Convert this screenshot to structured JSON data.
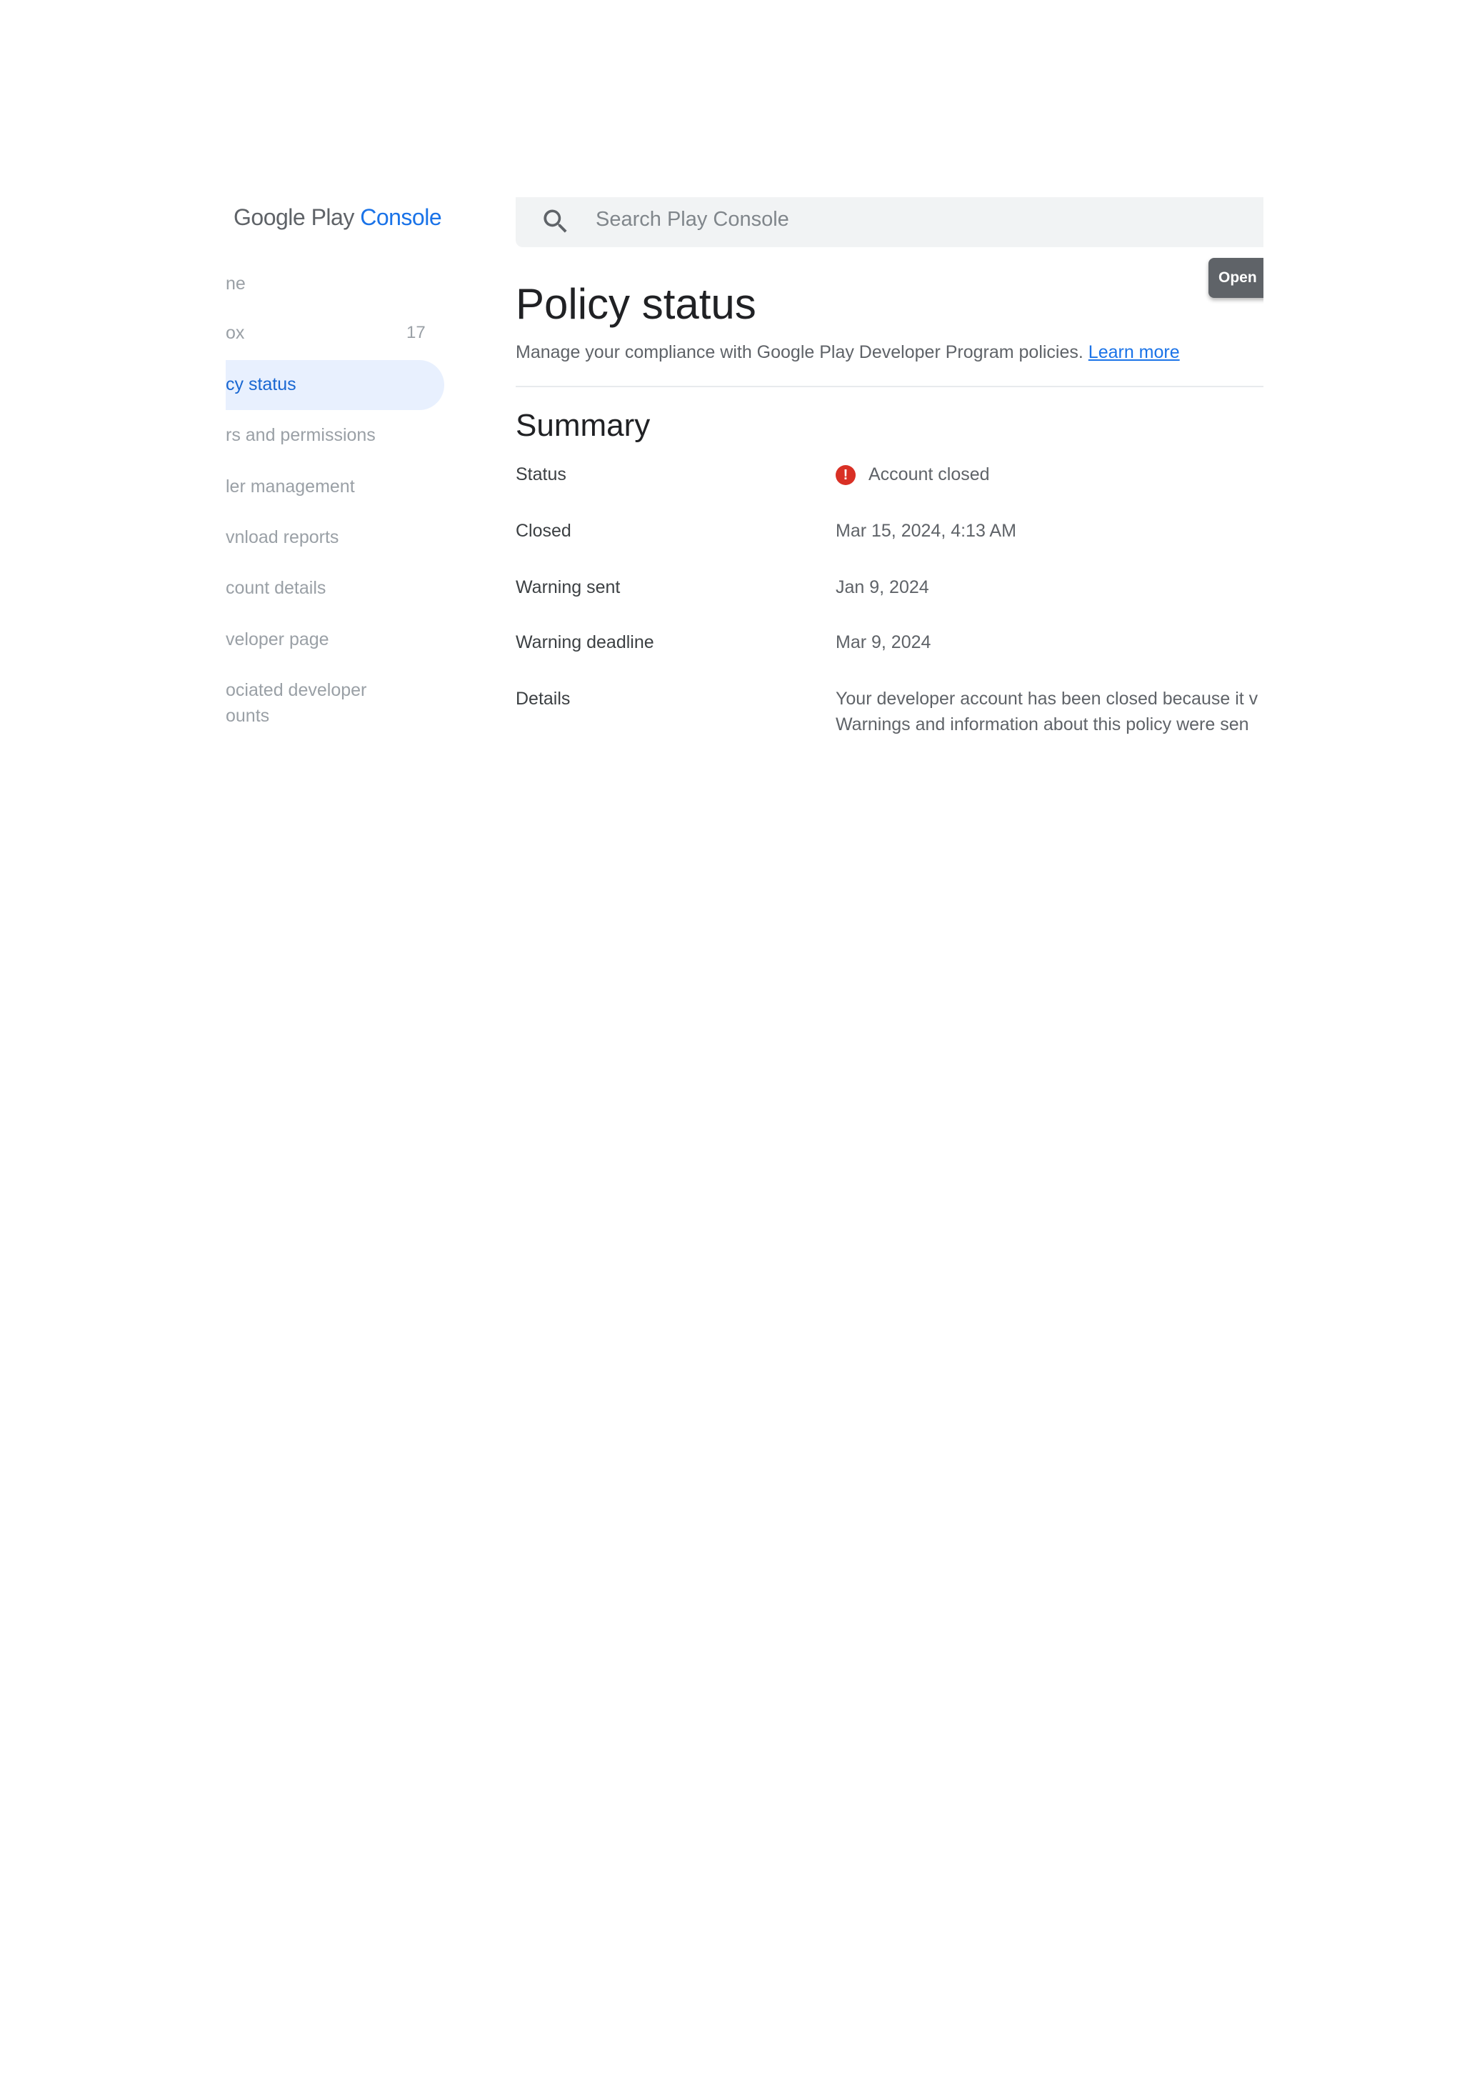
{
  "logo": {
    "part1": "Google Play",
    "part2": "Console"
  },
  "sidebar": {
    "items": [
      {
        "label": "ne"
      },
      {
        "label": "ox",
        "badge": "17"
      },
      {
        "label": "cy status",
        "active": true
      },
      {
        "label": "rs and permissions"
      },
      {
        "label": "ler management"
      },
      {
        "label": "vnload reports"
      },
      {
        "label": "count details"
      },
      {
        "label": "veloper page"
      },
      {
        "label": "ociated developer",
        "label2": "ounts"
      }
    ]
  },
  "search": {
    "placeholder": "Search Play Console",
    "icon": "search-icon"
  },
  "open_button": "Open",
  "page": {
    "title": "Policy status",
    "description": "Manage your compliance with Google Play Developer Program policies.",
    "learn_more": "Learn more",
    "summary_title": "Summary"
  },
  "summary": {
    "status_label": "Status",
    "status_value": "Account closed",
    "status_color": "#d93025",
    "closed_label": "Closed",
    "closed_value": "Mar 15, 2024, 4:13 AM",
    "warning_sent_label": "Warning sent",
    "warning_sent_value": "Jan 9, 2024",
    "warning_deadline_label": "Warning deadline",
    "warning_deadline_value": "Mar 9, 2024",
    "details_label": "Details",
    "details_line1": "Your developer account has been closed because it v",
    "details_line2": "Warnings and information about this policy were sen"
  }
}
